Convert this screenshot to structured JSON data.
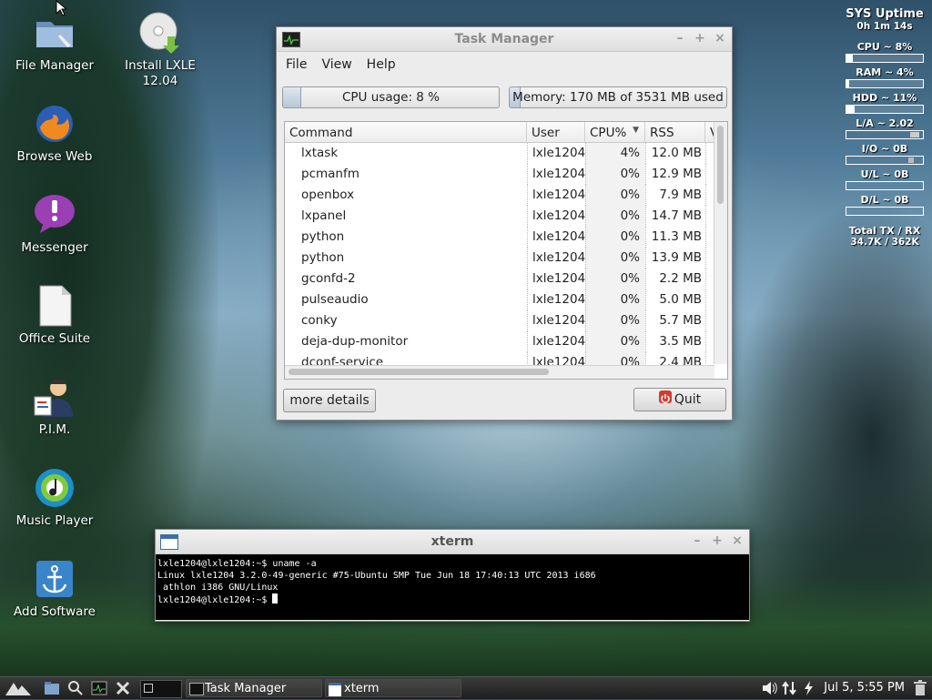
{
  "desktop": {
    "icons": [
      {
        "label": "File Manager",
        "icon": "folder-icon"
      },
      {
        "label": "Install LXLE\n12.04",
        "icon": "cd-install-icon"
      },
      {
        "label": "Browse Web",
        "icon": "firefox-icon"
      },
      {
        "label": "Messenger",
        "icon": "messenger-icon"
      },
      {
        "label": "Office Suite",
        "icon": "office-document-icon"
      },
      {
        "label": "P.I.M.",
        "icon": "pim-contact-icon"
      },
      {
        "label": "Music Player",
        "icon": "music-player-icon"
      },
      {
        "label": "Add Software",
        "icon": "software-anchor-icon"
      }
    ]
  },
  "conky": {
    "title": "SYS Uptime",
    "uptime": "0h 1m 14s",
    "cpu": "CPU ~ 8%",
    "cpu_pct": 8,
    "ram": "RAM ~ 4%",
    "ram_pct": 4,
    "hdd": "HDD ~ 11%",
    "hdd_pct": 11,
    "la": "L/A ~ 2.02",
    "io": "I/O ~    0B",
    "ul": "U/L ~    0B",
    "dl": "D/L ~    0B",
    "total_label": "Total TX / RX",
    "total_value": "34.7K / 362K"
  },
  "task_manager": {
    "title": "Task Manager",
    "menu": [
      "File",
      "View",
      "Help"
    ],
    "cpu_usage": "CPU usage: 8 %",
    "cpu_usage_pct": 8,
    "memory": "Memory: 170 MB of 3531 MB used",
    "memory_pct": 4.8,
    "columns": [
      "Command",
      "User",
      "CPU%",
      "RSS",
      "V"
    ],
    "rows": [
      {
        "cmd": "lxtask",
        "user": "lxle1204",
        "cpu": "4%",
        "rss": "12.0 MB"
      },
      {
        "cmd": "pcmanfm",
        "user": "lxle1204",
        "cpu": "0%",
        "rss": "12.9 MB"
      },
      {
        "cmd": "openbox",
        "user": "lxle1204",
        "cpu": "0%",
        "rss": "7.9 MB"
      },
      {
        "cmd": "lxpanel",
        "user": "lxle1204",
        "cpu": "0%",
        "rss": "14.7 MB"
      },
      {
        "cmd": "python",
        "user": "lxle1204",
        "cpu": "0%",
        "rss": "11.3 MB"
      },
      {
        "cmd": "python",
        "user": "lxle1204",
        "cpu": "0%",
        "rss": "13.9 MB"
      },
      {
        "cmd": "gconfd-2",
        "user": "lxle1204",
        "cpu": "0%",
        "rss": "2.2 MB"
      },
      {
        "cmd": "pulseaudio",
        "user": "lxle1204",
        "cpu": "0%",
        "rss": "5.0 MB"
      },
      {
        "cmd": "conky",
        "user": "lxle1204",
        "cpu": "0%",
        "rss": "5.7 MB"
      },
      {
        "cmd": "deja-dup-monitor",
        "user": "lxle1204",
        "cpu": "0%",
        "rss": "3.5 MB"
      },
      {
        "cmd": "dconf-service",
        "user": "lxle1204",
        "cpu": "0%",
        "rss": "2.4 MB"
      }
    ],
    "more_details": "more details",
    "quit": "Quit"
  },
  "xterm": {
    "title": "xterm",
    "lines": [
      "lxle1204@lxle1204:~$ uname -a",
      "Linux lxle1204 3.2.0-49-generic #75-Ubuntu SMP Tue Jun 18 17:40:13 UTC 2013 i686",
      " athlon i386 GNU/Linux",
      "lxle1204@lxle1204:~$ "
    ]
  },
  "taskbar": {
    "tasks": [
      "Task Manager",
      "xterm"
    ],
    "clock": "Jul  5,  5:55 PM"
  }
}
